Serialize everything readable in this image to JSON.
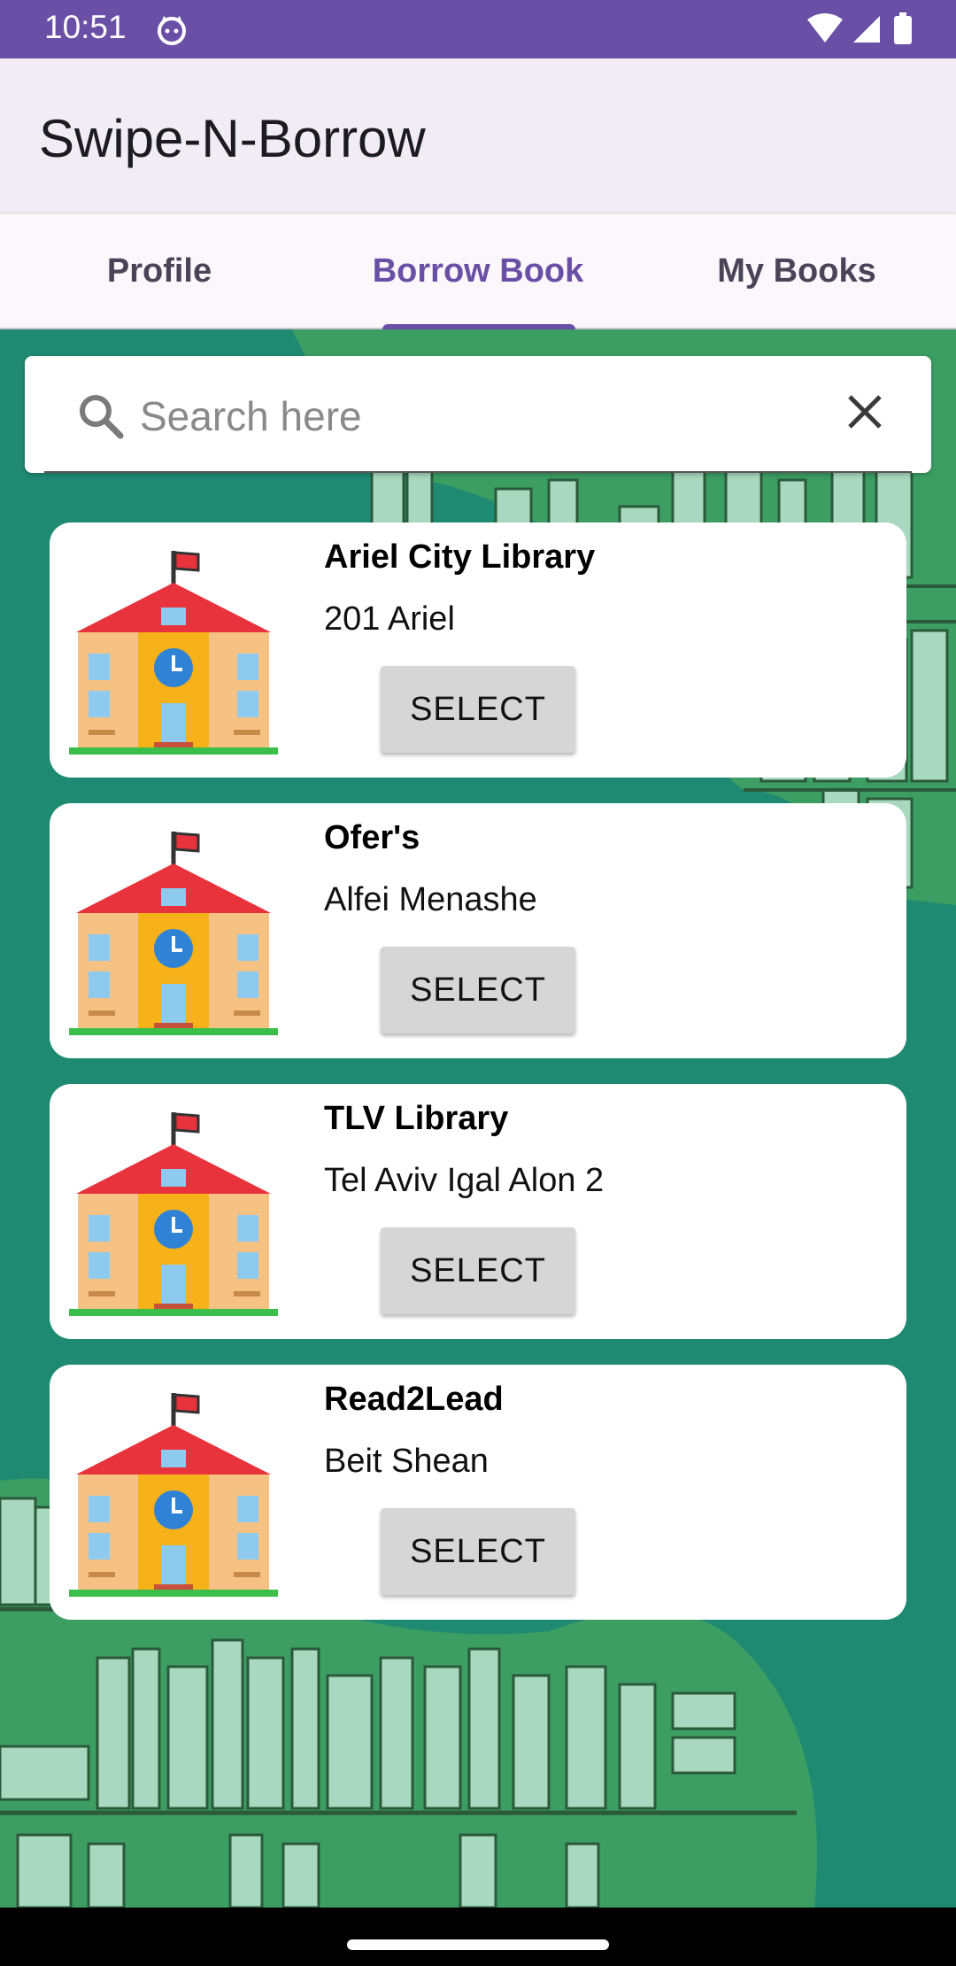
{
  "status_bar": {
    "time": "10:51"
  },
  "app_bar": {
    "title": "Swipe-N-Borrow"
  },
  "tabs": [
    {
      "label": "Profile",
      "selected": false
    },
    {
      "label": "Borrow Book",
      "selected": true
    },
    {
      "label": "My Books",
      "selected": false
    }
  ],
  "search": {
    "placeholder": "Search here",
    "value": ""
  },
  "libraries": [
    {
      "name": "Ariel City Library",
      "address": "201 Ariel",
      "button": "SELECT"
    },
    {
      "name": "Ofer's",
      "address": "Alfei Menashe",
      "button": "SELECT"
    },
    {
      "name": "TLV Library",
      "address": "Tel Aviv Igal Alon 2",
      "button": "SELECT"
    },
    {
      "name": "Read2Lead",
      "address": "Beit Shean",
      "button": "SELECT"
    }
  ],
  "colors": {
    "primary": "#6a4fa6",
    "app_bar_bg": "#f2edf5",
    "background_teal": "#1f8a72",
    "button_bg": "#d6d6d6"
  }
}
